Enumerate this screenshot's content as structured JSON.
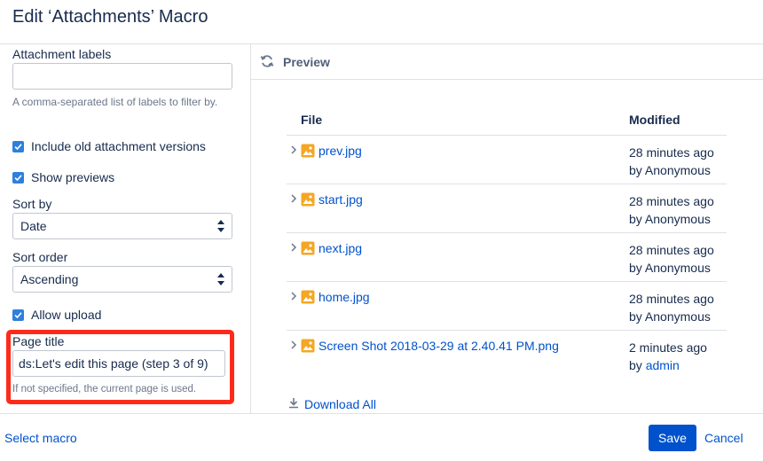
{
  "dialog": {
    "title": "Edit ‘Attachments’ Macro"
  },
  "left": {
    "attachment_labels": {
      "label": "Attachment labels",
      "value": "",
      "hint": "A comma-separated list of labels to filter by."
    },
    "include_old": {
      "label": "Include old attachment versions",
      "checked": true
    },
    "show_previews": {
      "label": "Show previews",
      "checked": true
    },
    "sort_by": {
      "label": "Sort by",
      "value": "Date"
    },
    "sort_order": {
      "label": "Sort order",
      "value": "Ascending"
    },
    "allow_upload": {
      "label": "Allow upload",
      "checked": true
    },
    "page_title": {
      "label": "Page title",
      "value": "ds:Let's edit this page (step 3 of 9)",
      "hint": "If not specified, the current page is used."
    }
  },
  "preview": {
    "title": "Preview",
    "columns": {
      "file": "File",
      "modified": "Modified"
    },
    "rows": [
      {
        "name": "prev.jpg",
        "time": "28 minutes ago",
        "by": "by",
        "user": "Anonymous",
        "user_is_link": false
      },
      {
        "name": "start.jpg",
        "time": "28 minutes ago",
        "by": "by",
        "user": "Anonymous",
        "user_is_link": false
      },
      {
        "name": "next.jpg",
        "time": "28 minutes ago",
        "by": "by",
        "user": "Anonymous",
        "user_is_link": false
      },
      {
        "name": "home.jpg",
        "time": "28 minutes ago",
        "by": "by",
        "user": "Anonymous",
        "user_is_link": false
      },
      {
        "name": "Screen Shot 2018-03-29 at 2.40.41 PM.png",
        "time": "2 minutes ago",
        "by": "by",
        "user": "admin",
        "user_is_link": true
      }
    ],
    "download_all": "Download All"
  },
  "footer": {
    "select_macro": "Select macro",
    "save": "Save",
    "cancel": "Cancel"
  },
  "colors": {
    "accent": "#0052cc",
    "checkbox": "#2f7fdc",
    "highlight": "#ff2a1a",
    "image_icon": "#f5a623"
  },
  "icons": {
    "refresh": "refresh-icon",
    "image": "image-file-icon",
    "expand": "chevron-right-icon",
    "download": "download-icon"
  }
}
